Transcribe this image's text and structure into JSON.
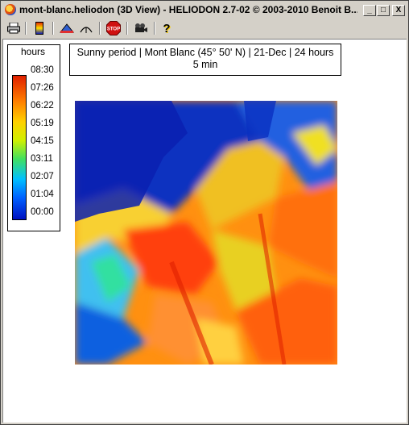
{
  "window": {
    "title": "mont-blanc.heliodon (3D View)  -  HELIODON 2.7-02 © 2003-2010 Benoit B...",
    "min_label": "_",
    "max_label": "□",
    "close_label": "X"
  },
  "toolbar": {
    "buttons": [
      {
        "name": "print",
        "icon": "printer-icon"
      },
      {
        "name": "legend",
        "icon": "color-scale-icon"
      },
      {
        "name": "relief",
        "icon": "terrain-icon"
      },
      {
        "name": "sun-path",
        "icon": "sun-path-icon"
      },
      {
        "name": "stop",
        "icon": "stop-icon",
        "label": "STOP"
      },
      {
        "name": "animation",
        "icon": "camera-icon"
      },
      {
        "name": "help",
        "icon": "help-icon",
        "label": "?"
      }
    ]
  },
  "legend": {
    "title": "hours",
    "ticks": [
      "08:30",
      "07:26",
      "06:22",
      "05:19",
      "04:15",
      "03:11",
      "02:07",
      "01:04",
      "00:00"
    ]
  },
  "header": {
    "line1": "Sunny period | Mont Blanc (45° 50' N) | 21-Dec | 24 hours",
    "line2": "5 min"
  },
  "colors": {
    "low": "#0010c0",
    "mid": "#40e060",
    "high": "#e02000"
  }
}
